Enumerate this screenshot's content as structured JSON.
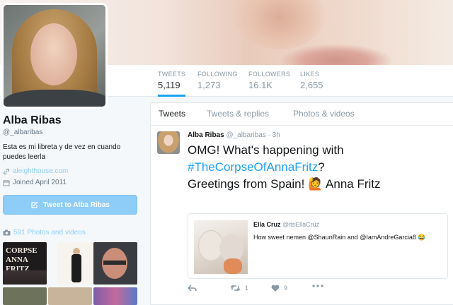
{
  "profile": {
    "name": "Alba Ribas",
    "handle": "@_albaribas",
    "bio": "Esta es mi libreta y de vez en cuando puedes leerla",
    "website": "aleighthouse.com",
    "joined": "Joined April 2011",
    "tweet_to_label": "Tweet to Alba Ribas",
    "photos_label": "591 Photos and videos"
  },
  "stats": [
    {
      "label": "TWEETS",
      "value": "5,119"
    },
    {
      "label": "FOLLOWING",
      "value": "1,273"
    },
    {
      "label": "FOLLOWERS",
      "value": "16.1K"
    },
    {
      "label": "LIKES",
      "value": "2,655"
    }
  ],
  "tabs": [
    "Tweets",
    "Tweets & replies",
    "Photos & videos"
  ],
  "tweet": {
    "name": "Alba Ribas",
    "handle": "@_albaribas",
    "time": "· 3h",
    "text_line1": "OMG! What's happening with",
    "hashtag": "#TheCorpseOfAnnaFritz",
    "text_q": "?",
    "text_line3": "Greetings from Spain! 🙋 Anna Fritz",
    "quote": {
      "name": "Ella Cruz",
      "handle": "@itsEllaCruz",
      "text": "How sweet nemen @ShaunRain and @IamAndreGarcia8 😂"
    },
    "retweets": "1",
    "likes": "9"
  },
  "thumbs": [
    {
      "text": "CORPSE ANNA FRITZ"
    }
  ],
  "colors": {
    "accent": "#1da1f2",
    "disabled_button": "#8ecdf8"
  }
}
